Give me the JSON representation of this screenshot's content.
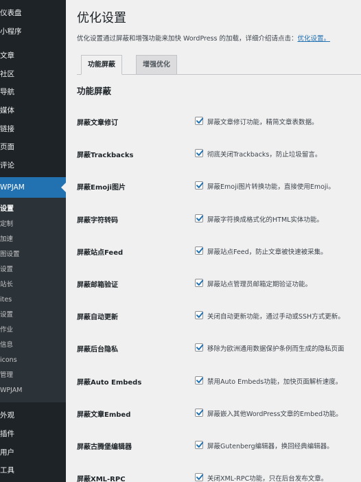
{
  "sidebar": {
    "top_items": [
      "仪表盘",
      "小程序"
    ],
    "main_items": [
      "文章",
      "社区",
      "导航",
      "媒体",
      "链接",
      "页面",
      "评论"
    ],
    "current": "WPJAM",
    "submenu": [
      "设置",
      "定制",
      "加速",
      "图设置",
      "设置",
      "站长",
      "ites",
      "设置",
      "作业",
      "信息",
      "icons",
      "管理",
      "WPJAM"
    ],
    "bottom_items": [
      "外观",
      "插件",
      "用户",
      "工具"
    ]
  },
  "page": {
    "title": "优化设置",
    "description": "优化设置通过屏蔽和增强功能来加快 WordPress 的加载，详细介绍请点击：",
    "description_link": "优化设置。"
  },
  "tabs": [
    {
      "label": "功能屏蔽",
      "active": true
    },
    {
      "label": "增强优化",
      "active": false
    }
  ],
  "section": {
    "title": "功能屏蔽"
  },
  "options": [
    {
      "label": "屏蔽文章修订",
      "desc": "屏蔽文章修订功能，精简文章表数据。",
      "checked": true
    },
    {
      "label": "屏蔽Trackbacks",
      "desc": "彻底关闭Trackbacks，防止垃圾留言。",
      "checked": true
    },
    {
      "label": "屏蔽Emoji图片",
      "desc": "屏蔽Emoji图片转换功能，直接使用Emoji。",
      "checked": true
    },
    {
      "label": "屏蔽字符转码",
      "desc": "屏蔽字符换成格式化的HTML实体功能。",
      "checked": true
    },
    {
      "label": "屏蔽站点Feed",
      "desc": "屏蔽站点Feed，防止文章被快速被采集。",
      "checked": true
    },
    {
      "label": "屏蔽邮箱验证",
      "desc": "屏蔽站点管理员邮箱定期验证功能。",
      "checked": true
    },
    {
      "label": "屏蔽自动更新",
      "desc": "关闭自动更新功能，通过手动或SSH方式更新。",
      "checked": true
    },
    {
      "label": "屏蔽后台隐私",
      "desc": "移除为欧洲通用数据保护条例而生成的隐私页面",
      "checked": true
    },
    {
      "label": "屏蔽Auto Embeds",
      "desc": "禁用Auto Embeds功能，加快页面解析速度。",
      "checked": true
    },
    {
      "label": "屏蔽文章Embed",
      "desc": "屏蔽嵌入其他WordPress文章的Embed功能。",
      "checked": true
    },
    {
      "label": "屏蔽古腾堡编辑器",
      "desc": "屏蔽Gutenberg编辑器，换回经典编辑器。",
      "checked": true
    },
    {
      "label": "屏蔽XML-RPC",
      "desc": "关闭XML-RPC功能，只在后台发布文章。",
      "checked": true
    }
  ],
  "colors": {
    "sidebar_bg": "#1d2327",
    "accent": "#2271b1",
    "page_bg": "#f0f0f1",
    "checkmark": "#2271b1"
  }
}
